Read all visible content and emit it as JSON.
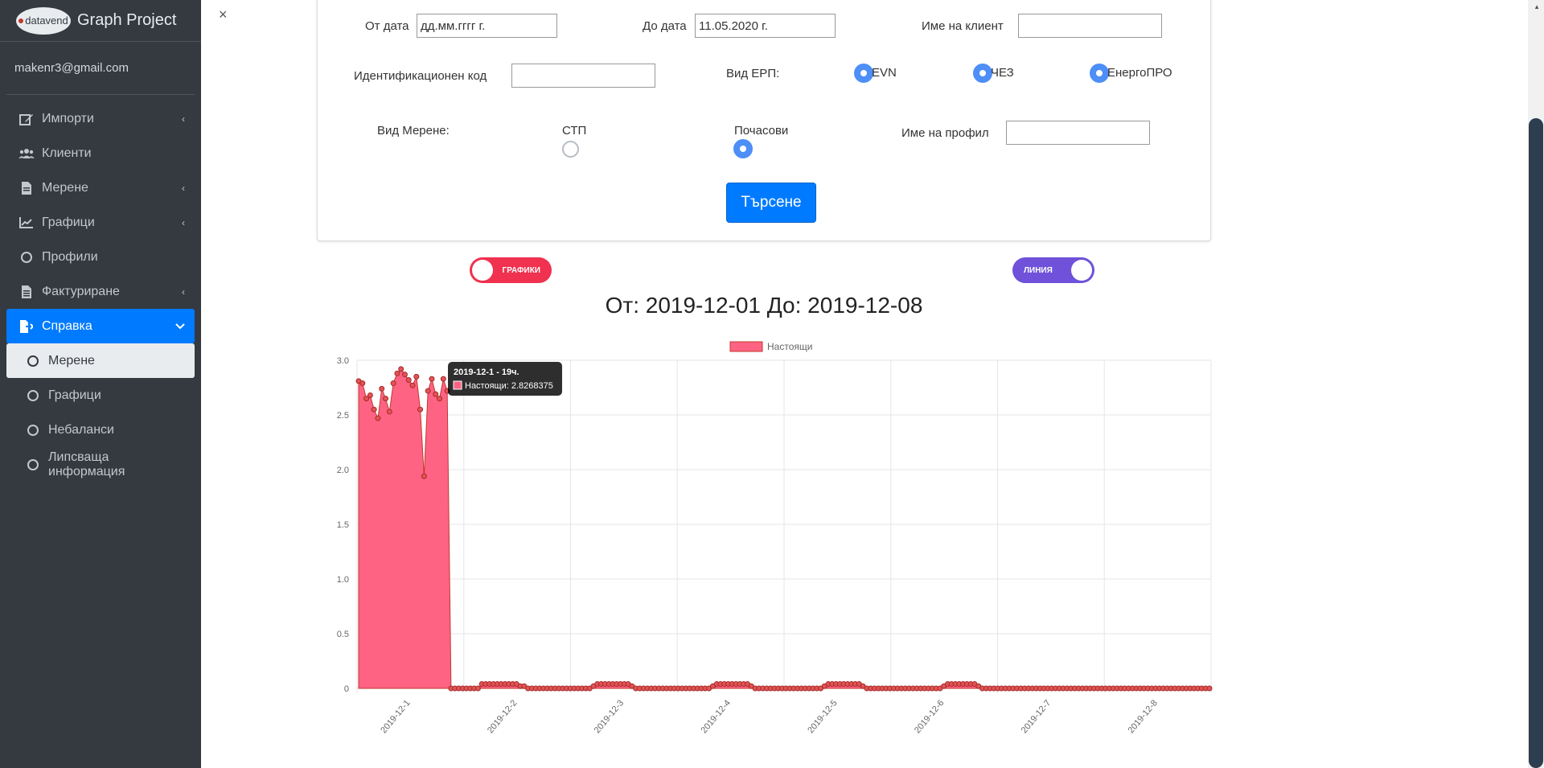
{
  "brand": {
    "logo_text": "datavend",
    "title": "Graph Project"
  },
  "user": {
    "email": "makenr3@gmail.com"
  },
  "nav": [
    {
      "label": "Импорти",
      "icon": "edit-icon",
      "chevron": "‹"
    },
    {
      "label": "Клиенти",
      "icon": "users-icon",
      "chevron": ""
    },
    {
      "label": "Мерене",
      "icon": "file-icon",
      "chevron": "‹"
    },
    {
      "label": "Графици",
      "icon": "chart-line-icon",
      "chevron": "‹"
    },
    {
      "label": "Профили",
      "icon": "circle-icon",
      "chevron": ""
    },
    {
      "label": "Фактуриране",
      "icon": "invoice-icon",
      "chevron": "‹"
    },
    {
      "label": "Справка",
      "icon": "file-export-icon",
      "chevron": "⌄",
      "active": true
    }
  ],
  "subnav": [
    {
      "label": "Мерене",
      "selected": true
    },
    {
      "label": "Графици"
    },
    {
      "label": "Небаланси"
    },
    {
      "label": "Липсваща информация"
    }
  ],
  "close_label": "×",
  "form": {
    "from_label": "От дата",
    "from_value": "дд.мм.гггг г.",
    "to_label": "До дата",
    "to_value": "11.05.2020 г.",
    "client_label": "Име на клиент",
    "client_value": "",
    "id_label": "Идентификационен код",
    "id_value": "",
    "erp_label": "Вид ЕРП:",
    "erp_options": [
      "EVN",
      "ЧЕЗ",
      "ЕнергоПРО"
    ],
    "measure_label": "Вид Мерене:",
    "measure_options": [
      "СТП",
      "Почасови"
    ],
    "measure_selected": "Почасови",
    "profile_label": "Име на профил",
    "profile_value": "",
    "search_label": "Търсене"
  },
  "toggles": {
    "left": {
      "label": "ГРАФИКИ",
      "color": "#f0314f",
      "on": false
    },
    "right": {
      "label": "ЛИНИЯ",
      "color": "#6f52d9",
      "on": true
    }
  },
  "chart_title": "От: 2019-12-01 До: 2019-12-08",
  "tooltip": {
    "title": "2019-12-1 - 19ч.",
    "body": "Настоящи: 2.8268375"
  },
  "chart_data": {
    "type": "area",
    "title": "От: 2019-12-01 До: 2019-12-08",
    "series": [
      {
        "name": "Настоящи",
        "color": "#ff6384",
        "border": "#c0392b",
        "values": [
          2.81,
          2.79,
          2.65,
          2.68,
          2.55,
          2.47,
          2.74,
          2.65,
          2.53,
          2.79,
          2.88,
          2.92,
          2.87,
          2.82,
          2.77,
          2.85,
          2.55,
          1.94,
          2.72,
          2.83,
          2.69,
          2.65,
          2.83,
          2.72,
          0,
          0,
          0,
          0,
          0,
          0,
          0,
          0,
          0.04,
          0.04,
          0.04,
          0.04,
          0.04,
          0.04,
          0.04,
          0.04,
          0.04,
          0.04,
          0.02,
          0.02,
          0,
          0,
          0,
          0,
          0,
          0,
          0,
          0,
          0,
          0,
          0,
          0,
          0,
          0,
          0,
          0,
          0,
          0.02,
          0.04,
          0.04,
          0.04,
          0.04,
          0.04,
          0.04,
          0.04,
          0.04,
          0.04,
          0.02,
          0,
          0,
          0,
          0,
          0,
          0,
          0,
          0,
          0,
          0,
          0,
          0,
          0,
          0,
          0,
          0,
          0,
          0,
          0,
          0,
          0.02,
          0.04,
          0.04,
          0.04,
          0.04,
          0.04,
          0.04,
          0.04,
          0.04,
          0.04,
          0.02,
          0,
          0,
          0,
          0,
          0,
          0,
          0,
          0,
          0,
          0,
          0,
          0,
          0,
          0,
          0,
          0,
          0,
          0,
          0.02,
          0.04,
          0.04,
          0.04,
          0.04,
          0.04,
          0.04,
          0.04,
          0.04,
          0.04,
          0.02,
          0,
          0,
          0,
          0,
          0,
          0,
          0,
          0,
          0,
          0,
          0,
          0,
          0,
          0,
          0,
          0,
          0,
          0,
          0,
          0,
          0.02,
          0.04,
          0.04,
          0.04,
          0.04,
          0.04,
          0.04,
          0.04,
          0.04,
          0.02,
          0,
          0,
          0,
          0,
          0,
          0,
          0,
          0,
          0,
          0,
          0,
          0,
          0,
          0,
          0,
          0,
          0,
          0,
          0,
          0,
          0,
          0,
          0,
          0,
          0,
          0,
          0,
          0,
          0,
          0,
          0,
          0,
          0,
          0,
          0,
          0,
          0,
          0,
          0,
          0,
          0,
          0,
          0,
          0,
          0,
          0,
          0,
          0,
          0,
          0,
          0,
          0,
          0,
          0,
          0,
          0,
          0,
          0,
          0,
          0
        ]
      }
    ],
    "x_ticks": [
      "2019-12-1",
      "2019-12-2",
      "2019-12-3",
      "2019-12-4",
      "2019-12-5",
      "2019-12-6",
      "2019-12-7",
      "2019-12-8"
    ],
    "y_ticks": [
      "3.0",
      "2.5",
      "2.0",
      "1.5",
      "1.0",
      "0.5",
      "0"
    ],
    "ylim": [
      0,
      3
    ],
    "legend": "top-center",
    "grid": true
  }
}
